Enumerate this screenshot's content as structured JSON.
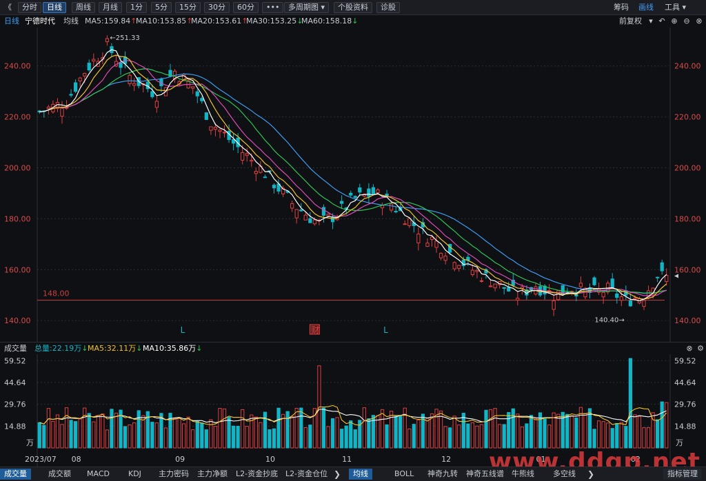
{
  "toolbar": {
    "back_glyph": "《",
    "buttons": [
      "分时",
      "日线",
      "周线",
      "月线",
      "1分",
      "5分",
      "15分",
      "30分",
      "60分",
      "•••",
      "多周期图 ▾",
      "个股资料",
      "诊股"
    ],
    "active_index": 1,
    "right": [
      "筹码",
      "画线",
      "工具 ▾"
    ],
    "right_active_index": 1
  },
  "header": {
    "period": "日线",
    "stock_name": "宁德时代",
    "ma_label": "均线",
    "ma": [
      {
        "label": "MA5:159.84",
        "dir": "↑",
        "color": "#ffffff"
      },
      {
        "label": "MA10:153.85",
        "dir": "↑",
        "color": "#f2c22b"
      },
      {
        "label": "MA20:153.61",
        "dir": "↑",
        "color": "#e04bb7"
      },
      {
        "label": "MA30:153.25",
        "dir": "↓",
        "color": "#2fc455"
      },
      {
        "label": "MA60:158.18",
        "dir": "↓",
        "color": "#3d9df3"
      }
    ],
    "adjust_label": "前复权",
    "tool_icons": [
      "dropdown-icon",
      "undo-icon",
      "zoom-in-icon",
      "zoom-out-icon",
      "close-icon"
    ]
  },
  "colors": {
    "up": "#e04040",
    "down": "#12b5c5",
    "grid": "#2a2d33",
    "axis_text": "#d84a4a",
    "ma5": "#ffffff",
    "ma10": "#f2c22b",
    "ma20": "#e04bb7",
    "ma30": "#2fc455",
    "ma60": "#3d9df3",
    "ref_line": "#c84040"
  },
  "chart_data": {
    "type": "candlestick",
    "y_ticks": [
      "240.00",
      "220.00",
      "200.00",
      "180.00",
      "160.00",
      "140.00"
    ],
    "ylim": [
      136,
      254
    ],
    "high_label": "251.33",
    "low_label": "140.40",
    "ref_level": 148.0,
    "ref_label": "148.00",
    "markers": [
      {
        "text": "L",
        "index": 32,
        "color": "#12b5c5"
      },
      {
        "text": "财",
        "index": 61,
        "color": "#e04040"
      },
      {
        "text": "L",
        "index": 77,
        "color": "#12b5c5"
      }
    ],
    "x_labels": [
      {
        "text": "2023/07",
        "index": 0
      },
      {
        "text": "08",
        "index": 8
      },
      {
        "text": "09",
        "index": 31
      },
      {
        "text": "10",
        "index": 51
      },
      {
        "text": "11",
        "index": 68
      },
      {
        "text": "12",
        "index": 90
      },
      {
        "text": "01",
        "index": 111
      },
      {
        "text": "02",
        "index": 132
      }
    ],
    "current_price_marker": 157.5
  },
  "volume": {
    "title": "成交量",
    "total": "总量:22.19万",
    "total_dir": "↓",
    "ma5": "MA5:32.11万",
    "ma5_dir": "↓",
    "ma10": "MA10:35.86万",
    "ma10_dir": "↓",
    "y_ticks": [
      "59.52",
      "44.64",
      "29.76",
      "14.88"
    ],
    "unit": "万",
    "ylim": [
      0,
      62
    ]
  },
  "tabs": {
    "left": [
      "成交量",
      "成交额",
      "MACD",
      "KDJ",
      "主力密码",
      "主力净额",
      "L2-资金抄底",
      "L2-资金仓位"
    ],
    "right": [
      "均线",
      "BOLL",
      "神奇九转",
      "神奇五线谱",
      "牛熊线",
      "多空线"
    ],
    "right_tail": "指标管理",
    "left_active": 0,
    "right_active": 0
  },
  "watermark": "www.ddgp.net"
}
